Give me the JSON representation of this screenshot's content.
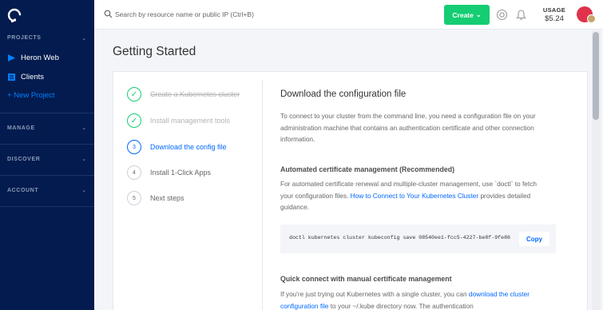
{
  "sidebar": {
    "projects_header": "PROJECTS",
    "items": [
      {
        "label": "Heron Web",
        "icon": "app-icon",
        "color": "#0080ff"
      },
      {
        "label": "Clients",
        "icon": "list-icon",
        "color": "#0080ff"
      }
    ],
    "new_project": "+ New Project",
    "sections": [
      "MANAGE",
      "DISCOVER",
      "ACCOUNT"
    ]
  },
  "header": {
    "search_placeholder": "Search by resource name or public IP (Ctrl+B)",
    "create_label": "Create",
    "usage_label": "USAGE",
    "usage_amount": "$5.24"
  },
  "page": {
    "title": "Getting Started"
  },
  "steps": [
    {
      "number": "✓",
      "label": "Create a Kubernetes cluster",
      "state": "done"
    },
    {
      "number": "✓",
      "label": "Install management tools",
      "state": "done"
    },
    {
      "number": "3",
      "label": "Download the config file",
      "state": "active"
    },
    {
      "number": "4",
      "label": "Install 1-Click Apps",
      "state": "pending"
    },
    {
      "number": "5",
      "label": "Next steps",
      "state": "pending"
    }
  ],
  "content": {
    "heading": "Download the configuration file",
    "intro": "To connect to your cluster from the command line, you need a configuration file on your administration machine that contains an authentication certificate and other connection information.",
    "auto_heading": "Automated certificate management (Recommended)",
    "auto_text_before": "For automated certificate renewal and multiple-cluster management, use `doctl` to fetch your configuration files. ",
    "auto_link": "How to Connect to Your Kubernetes Cluster",
    "auto_text_after": " provides detailed guidance.",
    "command": "doctl kubernetes cluster kubeconfig save 08540ee1-fcc5-4227-be8f-9fe86",
    "copy_label": "Copy",
    "quick_heading": "Quick connect with manual certificate management",
    "quick_text_before": "If you're just trying out Kubernetes with a single cluster, you can ",
    "quick_link": "download the cluster configuration file",
    "quick_text_after": " to your ~/.kube directory now. The authentication"
  },
  "colors": {
    "sidebar_bg": "#031b4e",
    "accent": "#0069ff",
    "create_green": "#15cd72"
  }
}
